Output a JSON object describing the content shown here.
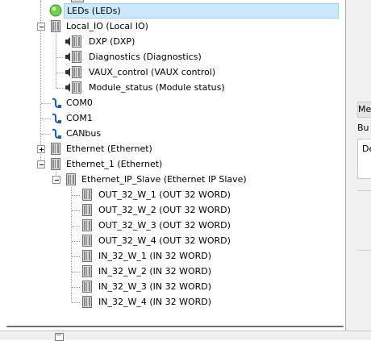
{
  "tree": {
    "items": [
      {
        "label": "LEDs (LEDs)",
        "icon": "leds-status-icon",
        "selected": true
      },
      {
        "label": "Local_IO (Local IO)",
        "icon": "io-module-icon"
      },
      {
        "label": "DXP (DXP)",
        "icon": "io-channel-icon"
      },
      {
        "label": "Diagnostics (Diagnostics)",
        "icon": "io-channel-icon"
      },
      {
        "label": "VAUX_control (VAUX control)",
        "icon": "io-channel-icon"
      },
      {
        "label": "Module_status (Module status)",
        "icon": "io-channel-icon"
      },
      {
        "label": "COM0",
        "icon": "serial-port-icon"
      },
      {
        "label": "COM1",
        "icon": "serial-port-icon"
      },
      {
        "label": "CANbus",
        "icon": "serial-port-icon"
      },
      {
        "label": "Ethernet (Ethernet)",
        "icon": "io-module-icon"
      },
      {
        "label": "Ethernet_1 (Ethernet)",
        "icon": "io-module-icon"
      },
      {
        "label": "Ethernet_IP_Slave (Ethernet IP Slave)",
        "icon": "io-module-icon"
      },
      {
        "label": "OUT_32_W_1 (OUT 32 WORD)",
        "icon": "io-module-icon"
      },
      {
        "label": "OUT_32_W_2 (OUT 32 WORD)",
        "icon": "io-module-icon"
      },
      {
        "label": "OUT_32_W_3 (OUT 32 WORD)",
        "icon": "io-module-icon"
      },
      {
        "label": "OUT_32_W_4 (OUT 32 WORD)",
        "icon": "io-module-icon"
      },
      {
        "label": "IN_32_W_1 (IN 32 WORD)",
        "icon": "io-module-icon"
      },
      {
        "label": "IN_32_W_2 (IN 32 WORD)",
        "icon": "io-module-icon"
      },
      {
        "label": "IN_32_W_3 (IN 32 WORD)",
        "icon": "io-module-icon"
      },
      {
        "label": "IN_32_W_4 (IN 32 WORD)",
        "icon": "io-module-icon"
      }
    ]
  },
  "right_panel": {
    "tab1": "Me",
    "tab2": "Bu",
    "cell": "De"
  },
  "colors": {
    "selection_bg": "#cce8ff",
    "selection_border": "#99d1ff",
    "led_green": "#6fd24a"
  }
}
